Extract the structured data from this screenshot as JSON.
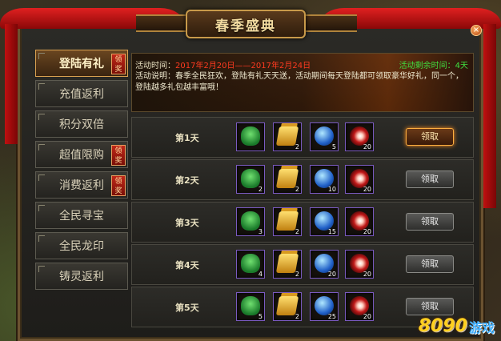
{
  "window": {
    "title": "春季盛典",
    "close_icon": "×"
  },
  "sidebar": {
    "items": [
      {
        "label": "登陆有礼",
        "active": true,
        "badge": "领奖"
      },
      {
        "label": "充值返利",
        "active": false,
        "badge": ""
      },
      {
        "label": "积分双倍",
        "active": false,
        "badge": ""
      },
      {
        "label": "超值限购",
        "active": false,
        "badge": "领奖"
      },
      {
        "label": "消费返利",
        "active": false,
        "badge": "领奖"
      },
      {
        "label": "全民寻宝",
        "active": false,
        "badge": ""
      },
      {
        "label": "全民龙印",
        "active": false,
        "badge": ""
      },
      {
        "label": "铸灵返利",
        "active": false,
        "badge": ""
      }
    ]
  },
  "banner": {
    "time_label": "活动时间：",
    "time_value": "2017年2月20日——2017年2月24日",
    "remaining_label": "活动剩余时间：",
    "remaining_value": "4天",
    "description": "活动说明：春季全民狂欢，登陆有礼天天送，活动期间每天登陆都可领取豪华好礼，同一个，登陆越多礼包越丰富哦！"
  },
  "rewards": {
    "claim_label": "领取",
    "rows": [
      {
        "day": "第1天",
        "items": [
          {
            "icon": "jade-dragon-icon",
            "qty": ""
          },
          {
            "icon": "gold-bar-icon",
            "qty": "2"
          },
          {
            "icon": "blue-orb-icon",
            "qty": "5"
          },
          {
            "icon": "red-orb-icon",
            "qty": "20"
          }
        ],
        "claimable": true
      },
      {
        "day": "第2天",
        "items": [
          {
            "icon": "jade-dragon-icon",
            "qty": "2"
          },
          {
            "icon": "gold-bar-icon",
            "qty": "2"
          },
          {
            "icon": "blue-orb-icon",
            "qty": "10"
          },
          {
            "icon": "red-orb-icon",
            "qty": "20"
          }
        ],
        "claimable": false
      },
      {
        "day": "第3天",
        "items": [
          {
            "icon": "jade-dragon-icon",
            "qty": "3"
          },
          {
            "icon": "gold-bar-icon",
            "qty": "2"
          },
          {
            "icon": "blue-orb-icon",
            "qty": "15"
          },
          {
            "icon": "red-orb-icon",
            "qty": "20"
          }
        ],
        "claimable": false
      },
      {
        "day": "第4天",
        "items": [
          {
            "icon": "jade-dragon-icon",
            "qty": "4"
          },
          {
            "icon": "gold-bar-icon",
            "qty": "2"
          },
          {
            "icon": "blue-orb-icon",
            "qty": "20"
          },
          {
            "icon": "red-orb-icon",
            "qty": "20"
          }
        ],
        "claimable": false
      },
      {
        "day": "第5天",
        "items": [
          {
            "icon": "jade-dragon-icon",
            "qty": "5"
          },
          {
            "icon": "gold-bar-icon",
            "qty": "2"
          },
          {
            "icon": "blue-orb-icon",
            "qty": "25"
          },
          {
            "icon": "red-orb-icon",
            "qty": "20"
          }
        ],
        "claimable": false
      }
    ]
  },
  "watermark": {
    "number": "8090",
    "brand": "游戏"
  },
  "colors": {
    "accent": "#d8a050",
    "ribbon": "#c01010",
    "highlight_time": "#ff3a20",
    "remaining": "#40e040"
  }
}
